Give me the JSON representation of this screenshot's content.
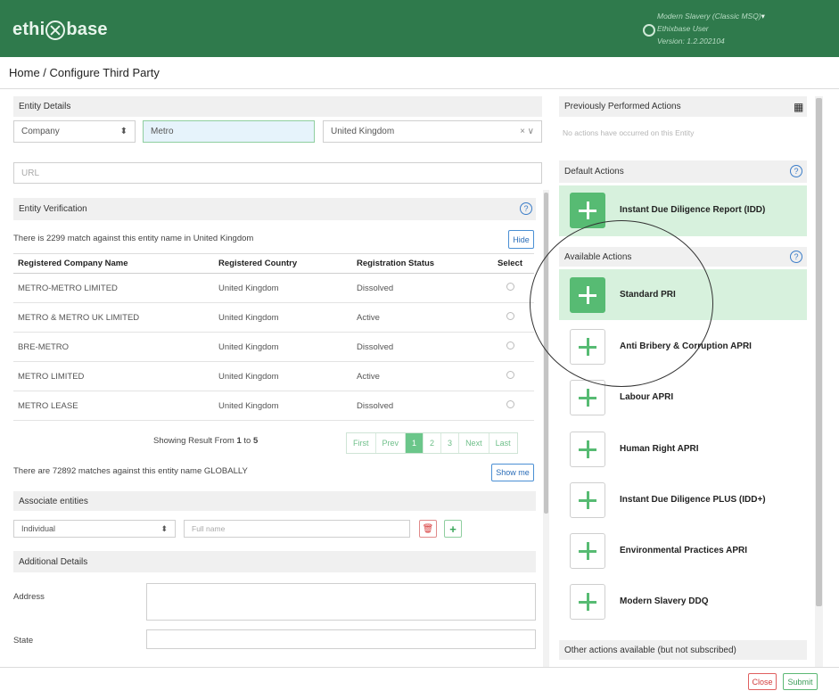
{
  "header": {
    "logo_left": "ethi",
    "logo_right": "base",
    "product": "Modern Slavery (Classic MSQ)",
    "user": "Ethixbase User",
    "version": "Version: 1.2.202104",
    "brand_color": "#2f7a4c"
  },
  "breadcrumb": "Home / Configure Third Party",
  "entity_details": {
    "title": "Entity Details",
    "type": "Company",
    "type_arrow": "⬍",
    "name": "Metro",
    "country": "United Kingdom",
    "country_controls": "× ∨",
    "url_placeholder": "URL"
  },
  "verification": {
    "title": "Entity Verification",
    "help": "?",
    "match_text": "There is 2299 match against this entity name in United Kingdom",
    "hide_label": "Hide",
    "columns": [
      "Registered Company Name",
      "Registered Country",
      "Registration Status",
      "Select"
    ],
    "rows": [
      {
        "name": "METRO-METRO LIMITED",
        "country": "United Kingdom",
        "status": "Dissolved"
      },
      {
        "name": "METRO & METRO UK LIMITED",
        "country": "United Kingdom",
        "status": "Active"
      },
      {
        "name": "BRE-METRO",
        "country": "United Kingdom",
        "status": "Dissolved"
      },
      {
        "name": "METRO LIMITED",
        "country": "United Kingdom",
        "status": "Active"
      },
      {
        "name": "METRO LEASE",
        "country": "United Kingdom",
        "status": "Dissolved"
      }
    ],
    "showing_prefix": "Showing Result From",
    "showing_from": "1",
    "showing_to_word": "to",
    "showing_to": "5",
    "pager": [
      "First",
      "Prev",
      "1",
      "2",
      "3",
      "Next",
      "Last"
    ],
    "global_text": "There are 72892 matches against this entity name GLOBALLY",
    "show_me_label": "Show me"
  },
  "associates": {
    "title": "Associate entities",
    "type": "Individual",
    "type_arrow": "⬍",
    "name_placeholder": "Full name",
    "delete_icon": "🗑",
    "add_icon": "+"
  },
  "additional": {
    "title": "Additional Details",
    "address_label": "Address",
    "state_label": "State"
  },
  "right": {
    "previous_title": "Previously Performed Actions",
    "grid_icon": "▦",
    "previous_empty": "No actions have occurred on this Entity",
    "default_title": "Default Actions",
    "default_actions": [
      "Instant Due Diligence Report (IDD)"
    ],
    "available_title": "Available Actions",
    "available_actions": [
      "Standard PRI",
      "Anti Bribery & Corruption APRI",
      "Labour APRI",
      "Human Right APRI",
      "Instant Due Diligence PLUS (IDD+)",
      "Environmental Practices APRI",
      "Modern Slavery DDQ"
    ],
    "other_title": "Other actions available (but not subscribed)",
    "help": "?"
  },
  "footer": {
    "close_label": "Close",
    "submit_label": "Submit"
  }
}
